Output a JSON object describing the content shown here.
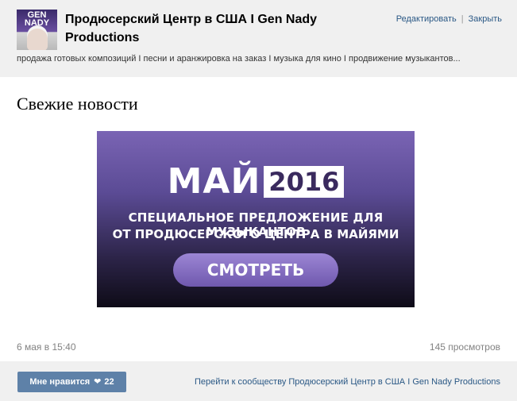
{
  "header": {
    "avatar_text": "GEN NADY PRODUCTIONS",
    "title": "Продюсерский Центр в США I Gen Nady Productions",
    "actions": [
      "Редактировать",
      "Закрыть"
    ],
    "description": "продажа готовых композиций I песни и аранжировка на заказ I музыка для кино I продвижение музыкантов..."
  },
  "section": {
    "heading": "Свежие новости"
  },
  "banner": {
    "month": "МАЙ",
    "year": "2016",
    "offer_line1": "СПЕЦИАЛЬНОЕ ПРЕДЛОЖЕНИЕ ДЛЯ МУЗЫКАНТОВ",
    "offer_line2": "ОТ ПРОДЮСЕРСКОГО ЦЕНТРА В МАЙЯМИ",
    "button_label": "СМОТРЕТЬ"
  },
  "post": {
    "date": "6 мая в 15:40",
    "views": "145 просмотров"
  },
  "footer": {
    "like_label": "Мне нравится",
    "like_count": "22",
    "community_link": "Перейти к сообществу Продюсерский Центр в США I Gen Nady Productions"
  },
  "colors": {
    "accent": "#2a5885",
    "like_button": "#5e81a8",
    "banner_purple": "#7a64b4"
  }
}
